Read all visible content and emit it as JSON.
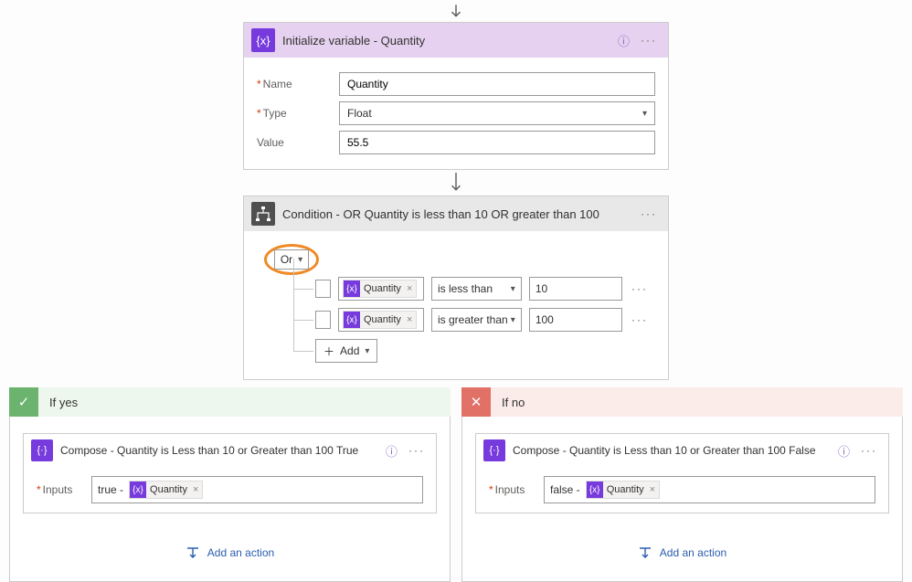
{
  "init": {
    "title": "Initialize variable - Quantity",
    "name_label": "Name",
    "name_value": "Quantity",
    "type_label": "Type",
    "type_value": "Float",
    "value_label": "Value",
    "value_value": "55.5"
  },
  "cond": {
    "title": "Condition - OR Quantity is less than 10 OR greater than 100",
    "group_op": "Or",
    "rows": [
      {
        "token": "Quantity",
        "op": "is less than",
        "val": "10"
      },
      {
        "token": "Quantity",
        "op": "is greater than",
        "val": "100"
      }
    ],
    "add_label": "Add"
  },
  "yes": {
    "header": "If yes",
    "compose_title": "Compose - Quantity is Less than 10 or Greater than 100 True",
    "inputs_label": "Inputs",
    "prefix": "true -",
    "token": "Quantity",
    "add_action": "Add an action"
  },
  "no": {
    "header": "If no",
    "compose_title": "Compose - Quantity is Less than 10 or Greater than 100 False",
    "inputs_label": "Inputs",
    "prefix": "false -",
    "token": "Quantity",
    "add_action": "Add an action"
  }
}
